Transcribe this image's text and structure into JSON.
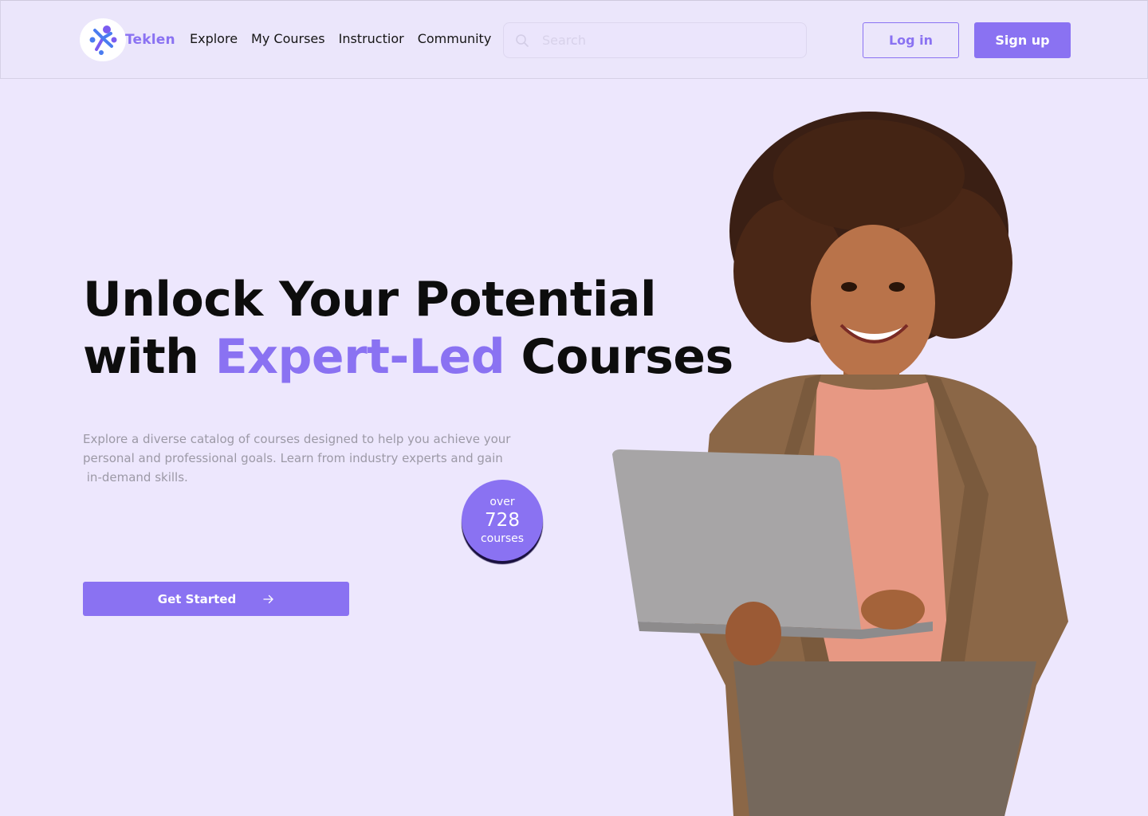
{
  "brand": {
    "name": "Teklen",
    "accent_color": "#8a72f2",
    "background_color": "#ede7fd"
  },
  "nav": {
    "items": [
      "Explore",
      "My Courses",
      "Instructior",
      "Community"
    ]
  },
  "search": {
    "placeholder": "Search",
    "icon": "search-icon"
  },
  "auth": {
    "login_label": "Log in",
    "signup_label": "Sign up"
  },
  "hero": {
    "title_line1": "Unlock Your Potential",
    "title_line2_prefix": "with ",
    "title_line2_accent": "Expert-Led",
    "title_line2_suffix": " Courses",
    "description_line1": "Explore a diverse catalog of courses designed to help you achieve your",
    "description_line2": "personal and professional goals. Learn from industry experts and gain",
    "description_line3": " in-demand skills.",
    "cta_label": "Get Started",
    "cta_icon": "arrow-right-icon"
  },
  "badge": {
    "prefix": "over",
    "count": "728",
    "suffix": "courses"
  }
}
